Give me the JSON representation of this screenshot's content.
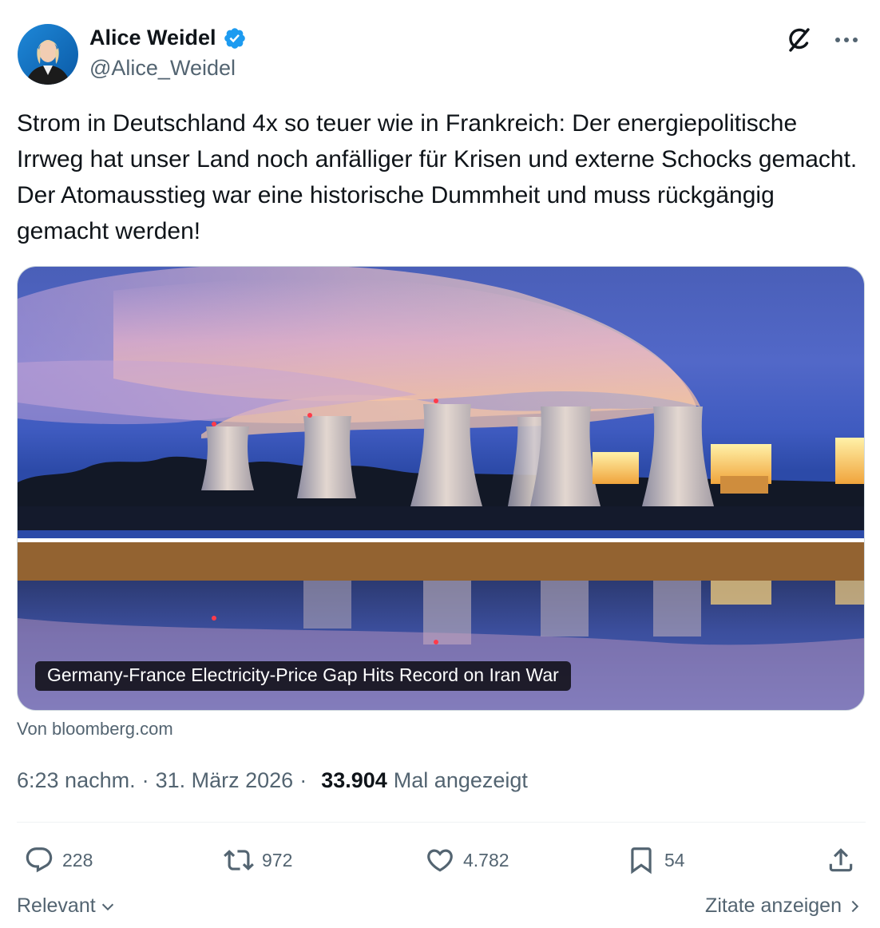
{
  "author": {
    "name": "Alice Weidel",
    "handle": "@Alice_Weidel",
    "verified": true,
    "verified_color": "#1d9bf0"
  },
  "top_actions": {
    "grok_icon": "grok-icon",
    "more_icon": "more-icon"
  },
  "tweet": {
    "text": "Strom in Deutschland 4x so teuer wie in Frankreich: Der energiepolitische Irrweg hat unser Land noch anfälliger für Krisen und externe Schocks gemacht. Der Atomausstieg war eine historische Dummheit und muss rückgängig gemacht werden!"
  },
  "card": {
    "title": "Germany-France Electricity-Price Gap Hits Record on Iran War",
    "source": "Von bloomberg.com"
  },
  "meta": {
    "time": "6:23 nachm.",
    "separator": "·",
    "date": "31. März 2026",
    "views_count": "33.904",
    "views_label": "Mal angezeigt"
  },
  "actions": {
    "replies": "228",
    "reposts": "972",
    "likes": "4.782",
    "bookmarks": "54"
  },
  "footer": {
    "sort_label": "Relevant",
    "quotes_label": "Zitate anzeigen"
  }
}
